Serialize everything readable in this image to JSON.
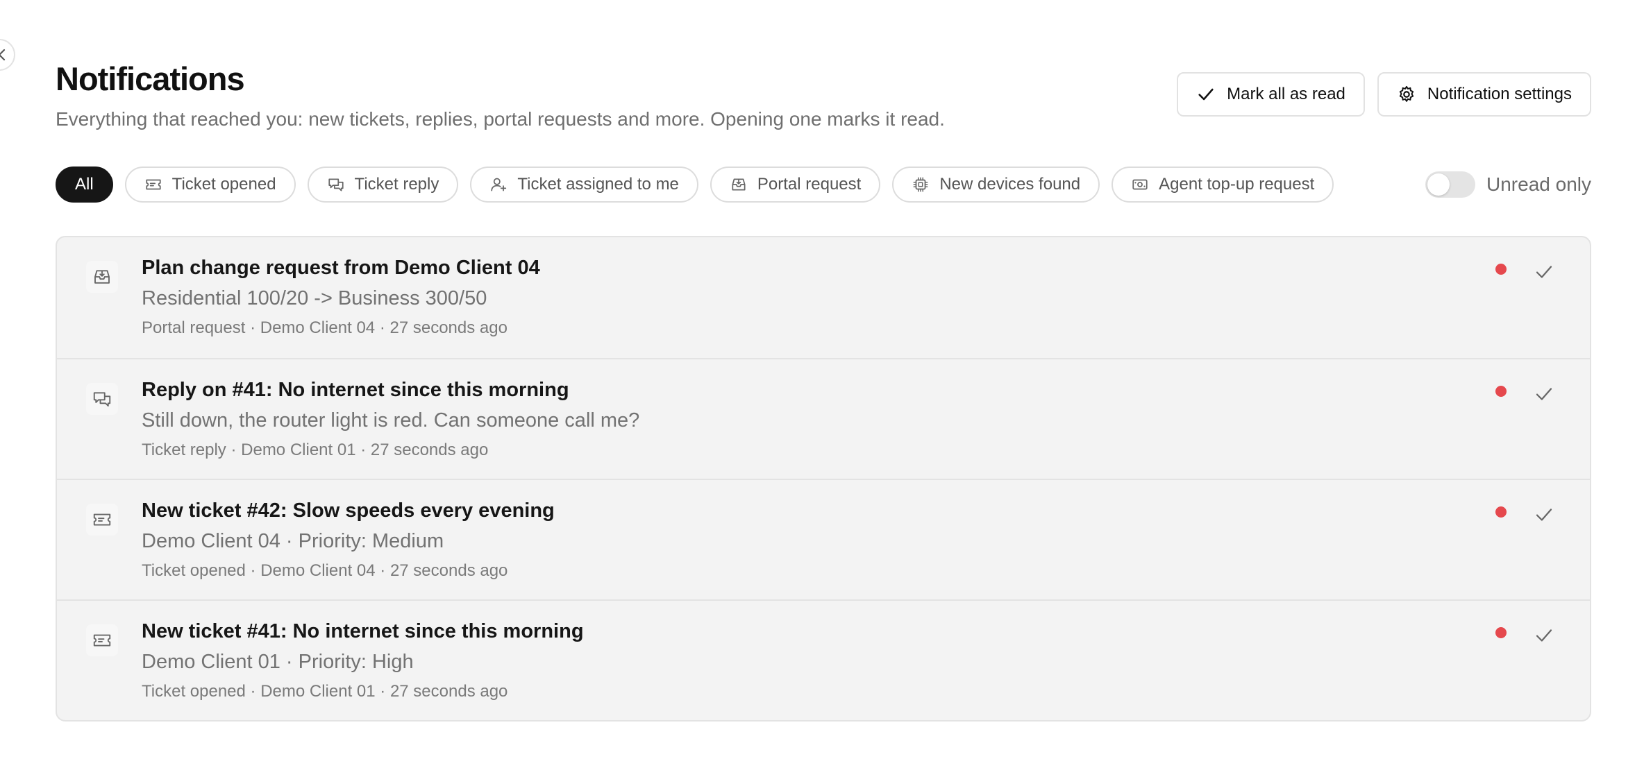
{
  "page": {
    "title": "Notifications",
    "subtitle": "Everything that reached you: new tickets, replies, portal requests and more. Opening one marks it read."
  },
  "actions": {
    "mark_all_read": "Mark all as read",
    "settings": "Notification settings"
  },
  "filters": [
    {
      "label": "All",
      "icon": "none",
      "active": true
    },
    {
      "label": "Ticket opened",
      "icon": "ticket-icon"
    },
    {
      "label": "Ticket reply",
      "icon": "chat-bubbles-icon"
    },
    {
      "label": "Ticket assigned to me",
      "icon": "user-plus-icon"
    },
    {
      "label": "Portal request",
      "icon": "inbox-icon"
    },
    {
      "label": "New devices found",
      "icon": "chip-icon"
    },
    {
      "label": "Agent top-up request",
      "icon": "money-icon"
    }
  ],
  "unread_toggle": {
    "label": "Unread only",
    "on": false
  },
  "notifications": [
    {
      "icon": "inbox-icon",
      "title": "Plan change request from Demo Client 04",
      "body": "Residential 100/20 -> Business 300/50",
      "meta": "Portal request · Demo Client 04 · 27 seconds ago",
      "unread": true
    },
    {
      "icon": "chat-bubbles-icon",
      "title": "Reply on #41: No internet since this morning",
      "body": "Still down, the router light is red. Can someone call me?",
      "meta": "Ticket reply · Demo Client 01 · 27 seconds ago",
      "unread": true
    },
    {
      "icon": "ticket-icon",
      "title": "New ticket #42: Slow speeds every evening",
      "body": "Demo Client 04 · Priority: Medium",
      "meta": "Ticket opened · Demo Client 04 · 27 seconds ago",
      "unread": true
    },
    {
      "icon": "ticket-icon",
      "title": "New ticket #41: No internet since this morning",
      "body": "Demo Client 01 · Priority: High",
      "meta": "Ticket opened · Demo Client 01 · 27 seconds ago",
      "unread": true
    }
  ],
  "colors": {
    "unread_dot": "#e5484d",
    "active_chip": "#161616",
    "list_bg": "#f3f3f3"
  }
}
